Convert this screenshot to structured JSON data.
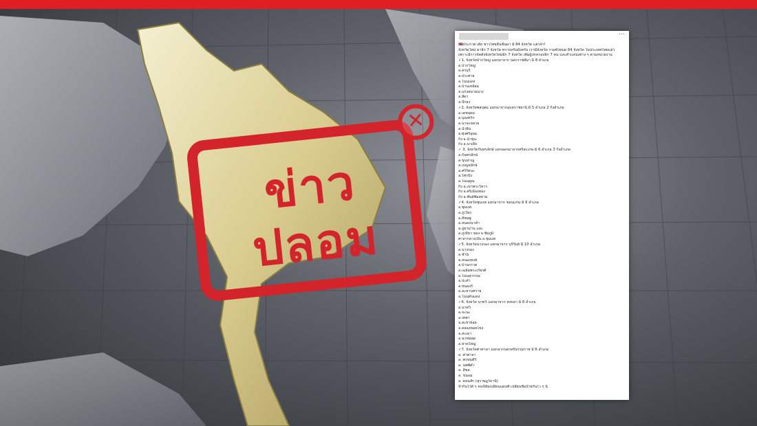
{
  "stamp": {
    "line1": "ข่าว",
    "line2": "ปลอม",
    "x_glyph": "✕",
    "color": "#d3242c"
  },
  "topbar_color": "#e01e24",
  "post": {
    "author_blurred": true,
    "menu_glyph": "···",
    "lines": [
      {
        "t": "🇹🇭ประกาศ เฮ้ย ชาวไทยตื่นขึ้นมา มี 84 จังหวัด แล้วจ้า!",
        "h": false
      },
      {
        "t": "จังหวัดใหม่ มาอีก 7 จังหวัด ทราบหรือยังครับ เรามีจังหวัด รวมทั้งหมด 84 จังหวัด ในประเทศไทยแล้ว",
        "h": false
      },
      {
        "t": "เพราะมีการจัดตั้งจังหวัดใหม่อีก 7 จังหวัด เพิ่มผู้ปกครองอีก 7 คน และตำแหน่งต่าง ๆ ตามหน่วยงาน",
        "h": false
      },
      {
        "t": "✓1. จังหวัดปากใหญ่ แยกมาจาก นครราชสีมา มี 8 อำเภอ",
        "h": true
      },
      {
        "t": "อ.ปากใหญ่",
        "h": false
      },
      {
        "t": "อ.ครบุรี",
        "h": false
      },
      {
        "t": "อ.ประทาย",
        "h": false
      },
      {
        "t": "อ.โนนแดง",
        "h": false
      },
      {
        "t": "อ.บ้านเหลื่อม",
        "h": false
      },
      {
        "t": "อ.แก้งสนามนาง",
        "h": false
      },
      {
        "t": "อ.สีดา",
        "h": false
      },
      {
        "t": "อ.ปักธง",
        "h": false
      },
      {
        "t": "✓2. จังหวัดพลบุตม แยกมาจากอุบลราชธานี มี 5 อำเภอ 2 กิ่งอำเภอ",
        "h": true
      },
      {
        "t": "อ.เดชอุดม",
        "h": false
      },
      {
        "t": "อ.บุณฑริก",
        "h": false
      },
      {
        "t": "อ.นาจะหลวย",
        "h": false
      },
      {
        "t": "อ.น้ำยืน",
        "h": false
      },
      {
        "t": "อ.ทุ่งศรีอุดม",
        "h": false
      },
      {
        "t": "กิ่ง อ.น้ำขุ่น",
        "h": false
      },
      {
        "t": "กิ่ง อ.นาเยีย",
        "h": false
      },
      {
        "t": "✓ 3. จังหวัดกันทรลักษ์ แยกออกมาจากศรีสะเกษ มี 6 อำเภอ 3 กิ่งอำเภอ",
        "h": true
      },
      {
        "t": "อ.กันทรลักษ์",
        "h": false
      },
      {
        "t": "อ.ขุนหาญ",
        "h": false
      },
      {
        "t": "อ.เบญจลักษ์",
        "h": false
      },
      {
        "t": "อ.ศรีรัตนะ",
        "h": false
      },
      {
        "t": "อ.ไพรบึง",
        "h": false
      },
      {
        "t": "อ.โนนคูณ",
        "h": false
      },
      {
        "t": "กิ่ง อ.เขาพระวิหาร",
        "h": false
      },
      {
        "t": "กิ่ง อ.ศรีเมืองทอง",
        "h": false
      },
      {
        "t": "กิ่ง อ.พันธ์พิมสยาม",
        "h": false
      },
      {
        "t": "✓4. จังหวัดชุมแพ แยกมาจาก ขอนแก่น มี 6 อำเภอ",
        "h": true
      },
      {
        "t": "อ.ชุมแพ",
        "h": false
      },
      {
        "t": "อ.ภูเวียง",
        "h": false
      },
      {
        "t": "อ.สีชมพู",
        "h": false
      },
      {
        "t": "อ.หนองนาคำ",
        "h": false
      },
      {
        "t": "อ.ภูผาม่าน และ",
        "h": false
      },
      {
        "t": "อ.ภูเขียว ของ    จ.ชัยภูมิ",
        "h": false
      },
      {
        "t": "ศาลากลางเป็น อ.ชุมแพ",
        "h": false
      },
      {
        "t": "✓5. จังหวัดนางรอง แยกมาจาก บุรีรัมย์  มี 10 อำเภอ",
        "h": true
      },
      {
        "t": "อ.นางรอง",
        "h": false
      },
      {
        "t": "อ.ชำนิ",
        "h": false
      },
      {
        "t": "อ.หนองหงส์",
        "h": false
      },
      {
        "t": "อ.บ้านกรวด",
        "h": false
      },
      {
        "t": "อ.เฉลิมพระเกียรติ",
        "h": false
      },
      {
        "t": "อ.โนนสุวรรณ",
        "h": false
      },
      {
        "t": "อ.ปะคำ",
        "h": false
      },
      {
        "t": "อ.หนองกี่",
        "h": false
      },
      {
        "t": "อ.ละหานทราย",
        "h": false
      },
      {
        "t": "อ.โนนดินแดง",
        "h": false
      },
      {
        "t": "✓6. จังหวัด นาทวี แยกมาจาก สงขลา มี 8 อำเภอ",
        "h": true
      },
      {
        "t": "อ.นาทวี",
        "h": false
      },
      {
        "t": "อ.จะนะ",
        "h": false
      },
      {
        "t": "อ.เทพา",
        "h": false
      },
      {
        "t": "อ.สะบ้าย้อย",
        "h": false
      },
      {
        "t": "อ.คลองหอยโข่ง",
        "h": false
      },
      {
        "t": "อ.สะเดา",
        "h": false
      },
      {
        "t": "อ.นาหม่อม",
        "h": false
      },
      {
        "t": "อ.หาดใหญ่",
        "h": false
      },
      {
        "t": "✓7. จังหวัดท่าศาลา แยกจากนครศรีธรรมราช มี 6  อำเภอ",
        "h": true
      },
      {
        "t": "อ. ท่าศาลา",
        "h": false
      },
      {
        "t": "อ. พรหมคีรี",
        "h": false
      },
      {
        "t": "อ. นพพิตำ",
        "h": false
      },
      {
        "t": "อ. สิชล",
        "h": false
      },
      {
        "t": "อ. ขนอม",
        "h": false
      },
      {
        "t": "อ. ดอนสัก  (สุราษฎร์ธานี)",
        "h": false
      },
      {
        "t": "จำกันไว้ดี ๆ คนขี้ลืมเปลี่ยนแผนที่ เปลี่ยนชื่อป้ายกันไว ๆ นี้",
        "h": true
      }
    ]
  }
}
